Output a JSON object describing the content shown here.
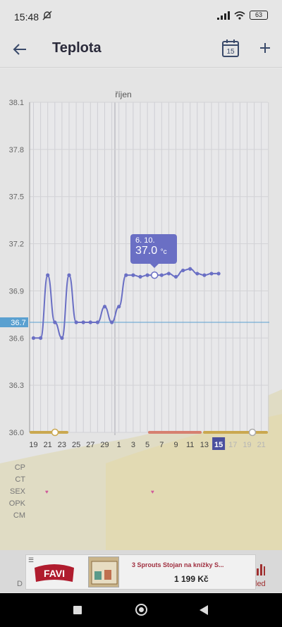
{
  "status_bar": {
    "time": "15:48",
    "battery": "63"
  },
  "header": {
    "title": "Teplota",
    "calendar_day": "15"
  },
  "chart_data": {
    "type": "line",
    "month_label": "říjen",
    "y_ticks": [
      "38.1",
      "37.8",
      "37.5",
      "37.2",
      "36.9",
      "36.6",
      "36.3",
      "36.0"
    ],
    "ylim": [
      36.0,
      38.1
    ],
    "coverline": 36.7,
    "coverline_label": "36.7",
    "x_ticks": [
      "19",
      "21",
      "23",
      "25",
      "27",
      "29",
      "1",
      "3",
      "5",
      "7",
      "9",
      "11",
      "13",
      "15",
      "17",
      "19",
      "21"
    ],
    "highlight_day": "6",
    "today_day": "15",
    "series": [
      {
        "values": [
          36.6,
          36.6,
          37.0,
          36.7,
          36.6,
          37.0,
          36.7,
          36.7,
          36.7,
          36.7,
          36.8,
          36.7,
          36.8,
          37.0,
          37.0,
          36.99,
          37.0,
          37.0,
          37.0,
          37.01,
          36.99,
          37.03,
          37.04,
          37.01,
          37.0,
          37.01,
          37.01
        ]
      }
    ],
    "tooltip": {
      "date": "6. 10.",
      "value": "37.0",
      "unit": "°c"
    },
    "colors": {
      "line": "#6a6fc4",
      "fertile": "#d68070",
      "period": "#caa850",
      "coverline": "#5aa0d0"
    }
  },
  "rows": {
    "labels": [
      "CP",
      "CT",
      "SEX",
      "OPK",
      "CM"
    ],
    "sex_marker": "♥"
  },
  "bottom": {
    "left_label": "D",
    "right_label": "led"
  },
  "ad": {
    "menu": "☰",
    "brand": "FAVI",
    "title": "3 Sprouts Stojan na knížky S...",
    "price": "1 199 Kč"
  }
}
